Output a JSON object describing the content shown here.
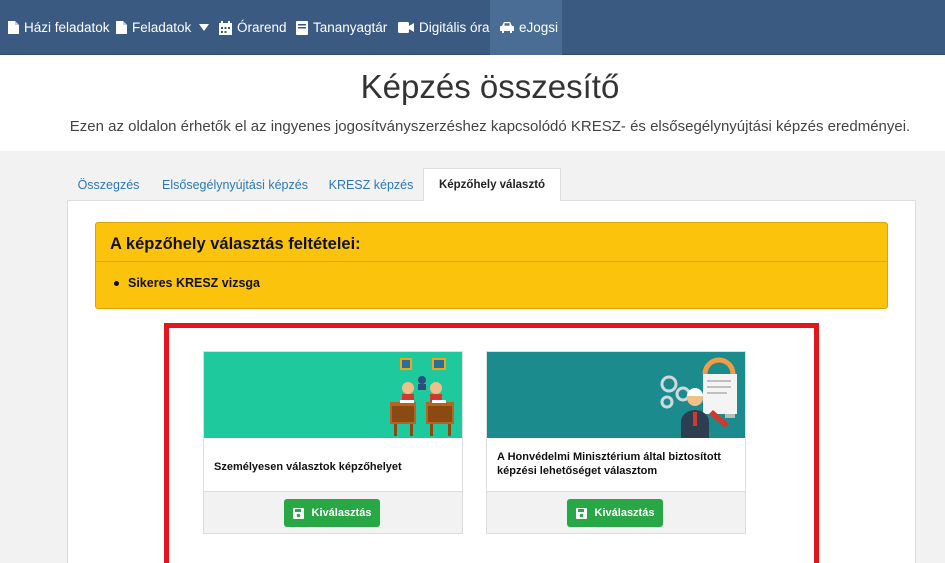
{
  "nav": {
    "items": [
      {
        "label": "Házi feladatok",
        "icon": "document-icon"
      },
      {
        "label": "Feladatok",
        "icon": "document-icon"
      },
      {
        "label": "Órarend",
        "icon": "calendar-icon"
      },
      {
        "label": "Tananyagtár",
        "icon": "book-icon"
      },
      {
        "label": "Digitális óra",
        "icon": "video-camera-icon"
      },
      {
        "label": "eJogsi",
        "icon": "car-icon"
      }
    ]
  },
  "header": {
    "title": "Képzés összesítő",
    "subtitle": "Ezen az oldalon érhetők el az ingyenes jogosítványszerzéshez kapcsolódó KRESZ- és elsősegélynyújtási képzés eredményei."
  },
  "tabs": [
    {
      "label": "Összegzés"
    },
    {
      "label": "Elsősegélynyújtási képzés"
    },
    {
      "label": "KRESZ képzés"
    },
    {
      "label": "Képzőhely választó"
    }
  ],
  "warning": {
    "title": "A képzőhely választás feltételei:",
    "items": [
      "Sikeres KRESZ vizsga"
    ]
  },
  "cards": [
    {
      "text": "Személyesen választok képzőhelyet",
      "button": "Kiválasztás"
    },
    {
      "text": "A Honvédelmi Minisztérium által biztosított képzési lehetőséget választom",
      "button": "Kiválasztás"
    }
  ],
  "colors": {
    "navbar": "#3b5a82",
    "warning": "#fcc30c",
    "highlight": "#e3141e",
    "button": "#28a745",
    "card1_image": "#1ec99e",
    "card2_image": "#1b8b8e"
  }
}
